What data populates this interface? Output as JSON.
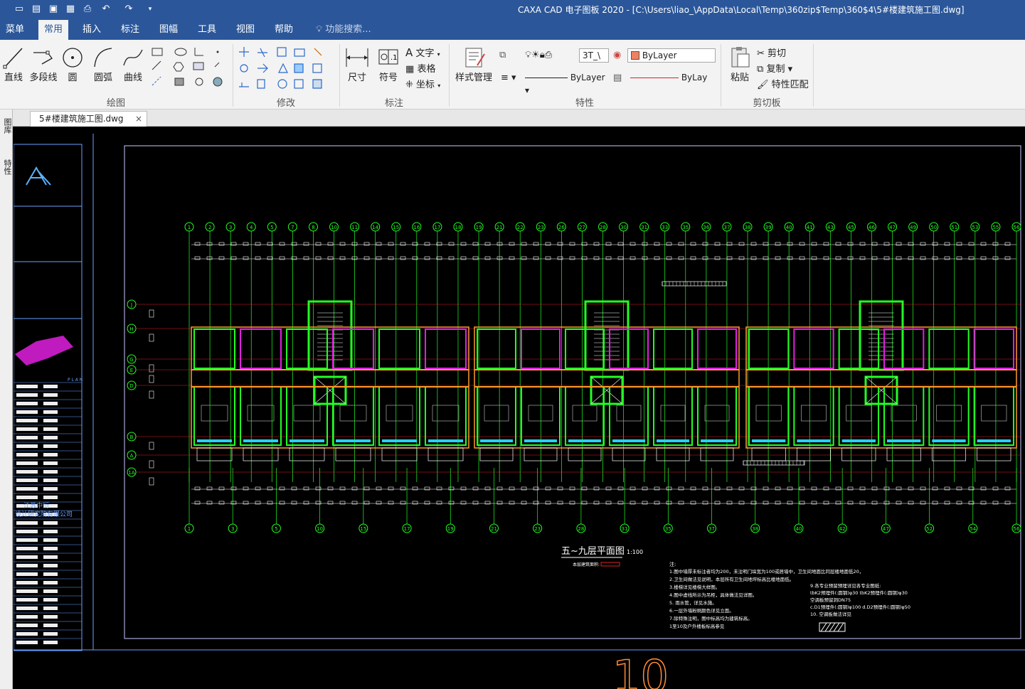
{
  "window": {
    "title": "CAXA CAD 电子图板 2020 - [C:\\Users\\liao_\\AppData\\Local\\Temp\\360zip$Temp\\360$4\\5#楼建筑施工图.dwg]"
  },
  "menu": {
    "items": [
      "菜单",
      "常用",
      "插入",
      "标注",
      "图幅",
      "工具",
      "视图",
      "帮助"
    ],
    "search_placeholder": "功能搜索..."
  },
  "ribbon": {
    "draw": {
      "title": "绘图",
      "line": "直线",
      "polyline": "多段线",
      "circle": "圆",
      "arc": "圆弧",
      "curve": "曲线"
    },
    "modify": {
      "title": "修改"
    },
    "annotate": {
      "title": "标注",
      "dimension": "尺寸",
      "symbol": "符号",
      "text": "文字",
      "table": "表格",
      "coord": "坐标"
    },
    "style": {
      "label": "样式管理"
    },
    "properties": {
      "title": "特性",
      "layer": "3T_\\",
      "color": "ByLayer",
      "linetype": "ByLayer",
      "lineweight": "ByLay"
    },
    "clipboard": {
      "title": "剪切板",
      "paste": "粘贴",
      "cut": "剪切",
      "copy": "复制",
      "match": "特性匹配"
    }
  },
  "tabs": {
    "doc": "5#楼建筑施工图.dwg",
    "close": "×"
  },
  "lefttool": {
    "a": "图库",
    "b": "特性"
  },
  "drawing": {
    "plan_title": "五~九层平面图",
    "scale": "1:100",
    "area_label": "本层建筑面积:",
    "notes_title": "注:",
    "company_line1": "江苏中衍",
    "company_line2": "设计研究院有限公司",
    "plan_label": "P L A N",
    "page_number": "10",
    "top_axes": [
      "1",
      "2",
      "3",
      "4",
      "5",
      "7",
      "8",
      "10",
      "11",
      "14",
      "15",
      "16",
      "17",
      "18",
      "19",
      "21",
      "22",
      "23",
      "26",
      "27",
      "28",
      "30",
      "31",
      "33",
      "35",
      "36",
      "37",
      "38",
      "39",
      "40",
      "41",
      "43",
      "45",
      "46",
      "47",
      "49",
      "50",
      "51",
      "53",
      "55",
      "56"
    ],
    "bottom_axes": [
      "1",
      "3",
      "5",
      "10",
      "15",
      "17",
      "19",
      "21",
      "23",
      "28",
      "31",
      "35",
      "37",
      "38",
      "40",
      "42",
      "47",
      "52",
      "54",
      "56"
    ],
    "row_axes": [
      "J",
      "H",
      "G",
      "E",
      "D",
      "B",
      "A",
      "1A"
    ],
    "notes": [
      "1.图中墙厚未标注者均为200，未注明门垛宽为100或居墙中，卫生间地面比同层楼地面低20，",
      "2.卫生间做法见说明，本层所有卫生间地坪标高比楼地面低。",
      "3.楼梯详见楼梯大样图。",
      "4.图中虚线所示为吊柜，具体做法见详图。",
      "5.     雨水管，详见水施。",
      "6.一层外墙粉刷颜色详见立面。",
      "7.除特殊注明，图中标高均为建筑标高。",
      "1至10及户外楼板标高参见"
    ],
    "notes_right": [
      "9.各专业预留预埋详见各专业图纸:",
      "tbK2预埋件(:圆钢)φ30   tbK2预埋件(:圆钢)φ30",
      "空调板预留洞DN75",
      "c.D1预埋件(:圆钢)φ100   d.D2预埋件(:圆钢)φ50",
      "10.    空调板做法详见"
    ]
  }
}
